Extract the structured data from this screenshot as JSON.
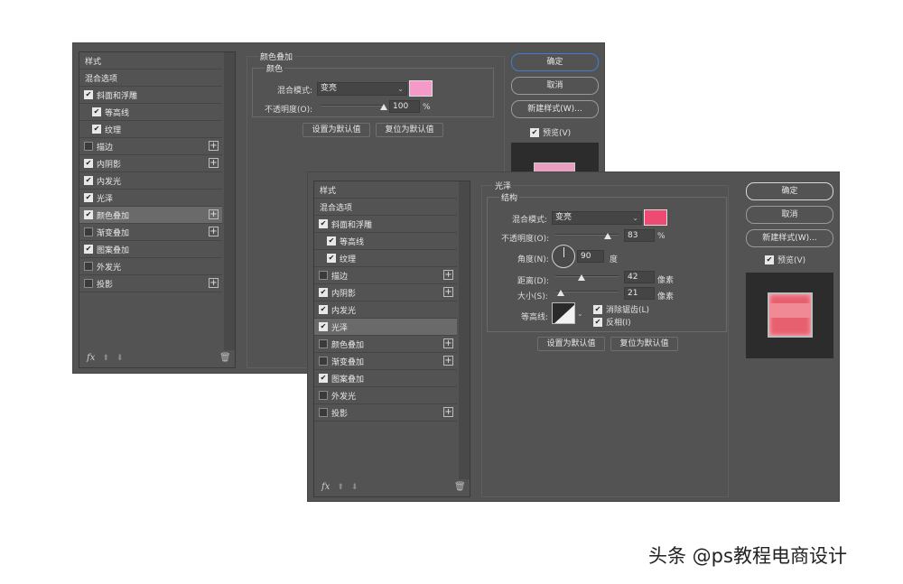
{
  "back_dialog": {
    "styles_header": "样式",
    "items": [
      {
        "label": "混合选项",
        "checkbox": false,
        "checked": false,
        "indent": false,
        "plus": false
      },
      {
        "label": "斜面和浮雕",
        "checkbox": true,
        "checked": true,
        "indent": false,
        "plus": false
      },
      {
        "label": "等高线",
        "checkbox": true,
        "checked": true,
        "indent": true,
        "plus": false
      },
      {
        "label": "纹理",
        "checkbox": true,
        "checked": true,
        "indent": true,
        "plus": false
      },
      {
        "label": "描边",
        "checkbox": true,
        "checked": false,
        "indent": false,
        "plus": true
      },
      {
        "label": "内阴影",
        "checkbox": true,
        "checked": true,
        "indent": false,
        "plus": true
      },
      {
        "label": "内发光",
        "checkbox": true,
        "checked": true,
        "indent": false,
        "plus": false
      },
      {
        "label": "光泽",
        "checkbox": true,
        "checked": true,
        "indent": false,
        "plus": false
      },
      {
        "label": "颜色叠加",
        "checkbox": true,
        "checked": true,
        "indent": false,
        "plus": true,
        "selected": true
      },
      {
        "label": "渐变叠加",
        "checkbox": true,
        "checked": false,
        "indent": false,
        "plus": true
      },
      {
        "label": "图案叠加",
        "checkbox": true,
        "checked": true,
        "indent": false,
        "plus": false
      },
      {
        "label": "外发光",
        "checkbox": true,
        "checked": false,
        "indent": false,
        "plus": false
      },
      {
        "label": "投影",
        "checkbox": true,
        "checked": false,
        "indent": false,
        "plus": true
      }
    ],
    "fx_label": "fx",
    "panel": {
      "title": "颜色叠加",
      "group_title": "颜色",
      "blend_label": "混合模式:",
      "blend_value": "变亮",
      "color": "#f59ac8",
      "opacity_label": "不透明度(O):",
      "opacity_value": "100",
      "opacity_unit": "%",
      "opacity_fraction": 1.0,
      "set_default": "设置为默认值",
      "reset_default": "复位为默认值"
    },
    "buttons": {
      "ok": "确定",
      "cancel": "取消",
      "new_style": "新建样式(W)...",
      "preview_label": "预览(V)",
      "preview_checked": true
    }
  },
  "front_dialog": {
    "styles_header": "样式",
    "items": [
      {
        "label": "混合选项",
        "checkbox": false,
        "checked": false,
        "indent": false,
        "plus": false
      },
      {
        "label": "斜面和浮雕",
        "checkbox": true,
        "checked": true,
        "indent": false,
        "plus": false
      },
      {
        "label": "等高线",
        "checkbox": true,
        "checked": true,
        "indent": true,
        "plus": false
      },
      {
        "label": "纹理",
        "checkbox": true,
        "checked": true,
        "indent": true,
        "plus": false
      },
      {
        "label": "描边",
        "checkbox": true,
        "checked": false,
        "indent": false,
        "plus": true
      },
      {
        "label": "内阴影",
        "checkbox": true,
        "checked": true,
        "indent": false,
        "plus": true
      },
      {
        "label": "内发光",
        "checkbox": true,
        "checked": true,
        "indent": false,
        "plus": false
      },
      {
        "label": "光泽",
        "checkbox": true,
        "checked": true,
        "indent": false,
        "plus": false,
        "selected": true
      },
      {
        "label": "颜色叠加",
        "checkbox": true,
        "checked": false,
        "indent": false,
        "plus": true
      },
      {
        "label": "渐变叠加",
        "checkbox": true,
        "checked": false,
        "indent": false,
        "plus": true
      },
      {
        "label": "图案叠加",
        "checkbox": true,
        "checked": true,
        "indent": false,
        "plus": false
      },
      {
        "label": "外发光",
        "checkbox": true,
        "checked": false,
        "indent": false,
        "plus": false
      },
      {
        "label": "投影",
        "checkbox": true,
        "checked": false,
        "indent": false,
        "plus": true
      }
    ],
    "fx_label": "fx",
    "panel": {
      "title": "光泽",
      "group_title": "结构",
      "blend_label": "混合模式:",
      "blend_value": "变亮",
      "color": "#ee4a72",
      "opacity_label": "不透明度(O):",
      "opacity_value": "83",
      "opacity_unit": "%",
      "opacity_fraction": 0.83,
      "angle_label": "角度(N):",
      "angle_value": "90",
      "angle_unit": "度",
      "distance_label": "距离(D):",
      "distance_value": "42",
      "distance_unit": "像素",
      "distance_fraction": 0.42,
      "size_label": "大小(S):",
      "size_value": "21",
      "size_unit": "像素",
      "size_fraction": 0.09,
      "contour_label": "等高线:",
      "antialias_label": "消除锯齿(L)",
      "antialias_checked": true,
      "invert_label": "反相(I)",
      "invert_checked": true,
      "set_default": "设置为默认值",
      "reset_default": "复位为默认值"
    },
    "buttons": {
      "ok": "确定",
      "cancel": "取消",
      "new_style": "新建样式(W)...",
      "preview_label": "预览(V)",
      "preview_checked": true
    }
  },
  "watermark": "头条 @ps教程电商设计"
}
